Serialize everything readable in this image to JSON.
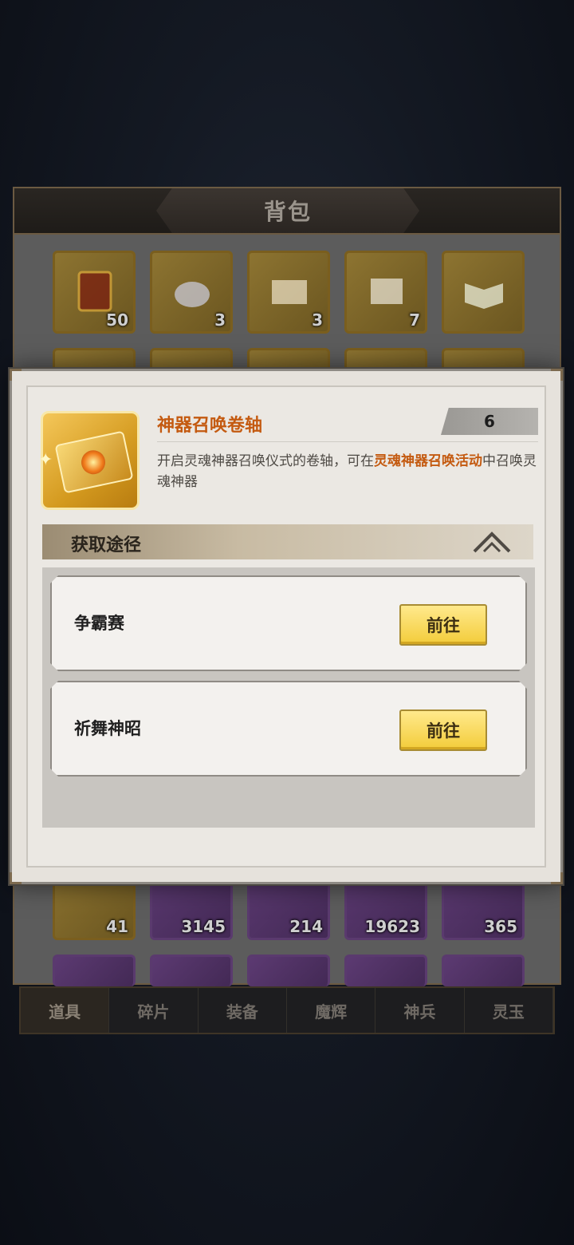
{
  "bag": {
    "title": "背包",
    "row1": [
      {
        "qty": "50",
        "icon": "scroll-card-icon"
      },
      {
        "qty": "3",
        "icon": "pouch-icon"
      },
      {
        "qty": "3",
        "icon": "book-icon"
      },
      {
        "qty": "7",
        "icon": "scroll-icon"
      },
      {
        "qty": "",
        "icon": "open-book-icon"
      }
    ],
    "row_partial": [
      {
        "qty": "41",
        "icon": "blue-gem-icon"
      },
      {
        "qty": "3145",
        "icon": "feather-icon"
      },
      {
        "qty": "214",
        "icon": "crystal-icon"
      },
      {
        "qty": "19623",
        "icon": "orb-icon"
      },
      {
        "qty": "365",
        "icon": "red-crystal-icon"
      }
    ],
    "tabs": [
      "道具",
      "碎片",
      "装备",
      "魔辉",
      "神兵",
      "灵玉"
    ],
    "active_tab": "道具"
  },
  "modal": {
    "item_name": "神器召唤卷轴",
    "count": "6",
    "desc_prefix": "开启灵魂神器召唤仪式的卷轴，可在",
    "desc_highlight": "灵魂神器召唤活动",
    "desc_suffix": "中召唤灵魂神器",
    "section_title": "获取途径",
    "sources": [
      {
        "label": "争霸赛",
        "button": "前往"
      },
      {
        "label": "祈舞神昭",
        "button": "前往"
      }
    ],
    "colors": {
      "highlight": "#c45a10",
      "button": "#f3cc3a"
    }
  }
}
